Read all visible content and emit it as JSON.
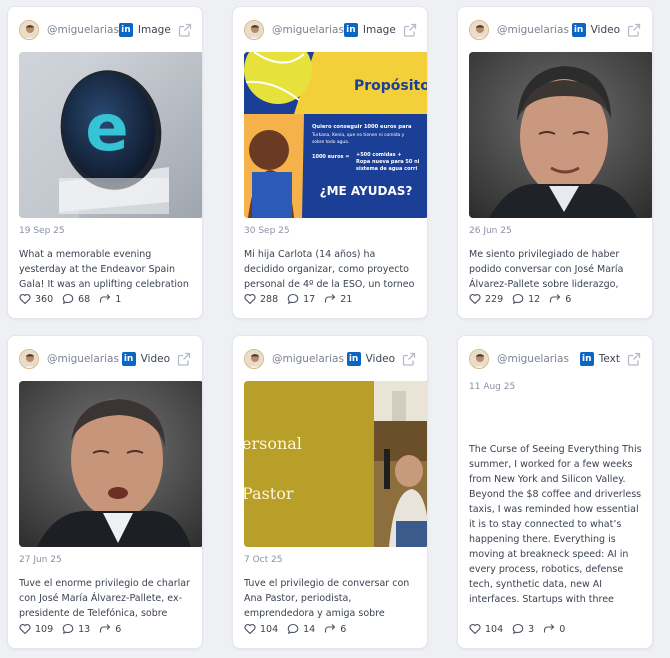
{
  "colors": {
    "linkedin": "#0a66c2",
    "card_bg": "#ffffff",
    "page_bg": "#eef0f4"
  },
  "cards": [
    {
      "username": "@miguelarias",
      "platform_icon": "linkedin-icon",
      "type": "Image",
      "date": "19 Sep 25",
      "text": "What a memorable evening yesterday at the Endeavor Spain Gala! It was an uplifting celebration of everything the…",
      "likes": "360",
      "comments": "68",
      "reposts": "1"
    },
    {
      "username": "@miguelarias",
      "platform_icon": "linkedin-icon",
      "type": "Image",
      "date": "30 Sep 25",
      "text": "Mi hija Carlota (14 años) ha decidido organizar, como proyecto personal de 4º de la ESO, un torneo benéfico de pádel…",
      "likes": "288",
      "comments": "17",
      "reposts": "21",
      "image_text": {
        "heading": "Propósito",
        "line1": "Quiero conseguir 1000 euros para",
        "line2": "Turkana, Kenia, que no tienen ni comida y",
        "line3": "sobre todo agua.",
        "eq_left": "1000 euros =",
        "eq_right1": "+500 comidas +",
        "eq_right2": "Ropa nueva para 50 ni",
        "eq_right3": "sistema de agua corri",
        "cta": "¿ME AYUDAS?"
      }
    },
    {
      "username": "@miguelarias",
      "platform_icon": "linkedin-icon",
      "type": "Video",
      "date": "26 Jun 25",
      "text": "Me siento privilegiado de haber podido conversar con José María Álvarez-Pallete sobre liderazgo, valores y propósito. Una…",
      "likes": "229",
      "comments": "12",
      "reposts": "6"
    },
    {
      "username": "@miguelarias",
      "platform_icon": "linkedin-icon",
      "type": "Video",
      "date": "27 Jun 25",
      "text": "Tuve el enorme privilegio de charlar con José María Álvarez-Pallete, ex-presidente de Telefónica, sobre liderazgo, valores,…",
      "likes": "109",
      "comments": "13",
      "reposts": "6"
    },
    {
      "username": "@miguelarias",
      "platform_icon": "linkedin-icon",
      "type": "Video",
      "date": "7 Oct 25",
      "text": "Tuve el privilegio de conversar con Ana Pastor, periodista, emprendedora y amiga sobre raíces, coraje, miedo,…",
      "likes": "104",
      "comments": "14",
      "reposts": "6",
      "image_text": {
        "line1": "ersonal",
        "line2": "Pastor"
      }
    },
    {
      "username": "@miguelarias",
      "platform_icon": "linkedin-icon",
      "type": "Text",
      "date": "11 Aug 25",
      "text": "The Curse of Seeing Everything This summer, I worked for a few weeks from New York and Silicon Valley. Beyond the $8 coffee and driverless taxis, I was reminded how essential it is to stay connected to what’s happening there. Everything is moving at breakneck speed: AI in every process, robotics, defense tech, synthetic data, new AI interfaces. Startups with three people are finding product–market…",
      "likes": "104",
      "comments": "3",
      "reposts": "0"
    }
  ]
}
